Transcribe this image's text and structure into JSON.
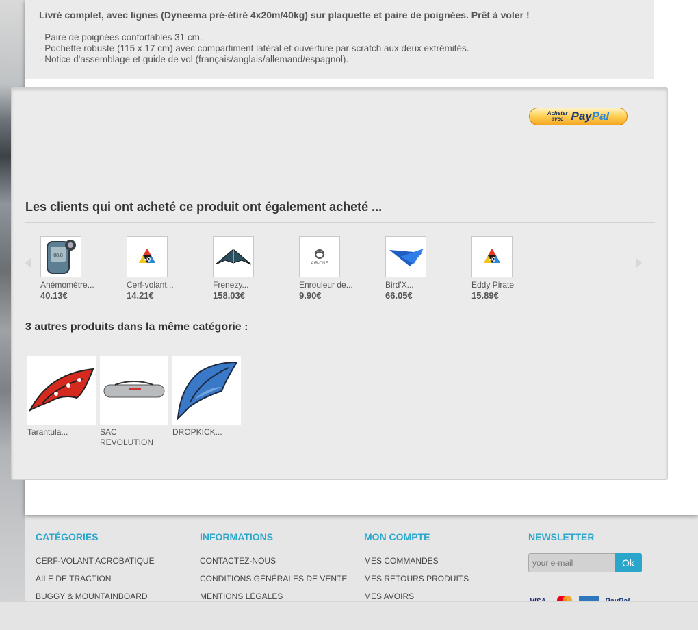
{
  "description": {
    "lead": "Livré complet, avec lignes (Dyneema pré-étiré 4x20m/40kg) sur plaquette et paire de poignées. Prêt à voler !",
    "lines": [
      "- Paire de poignées confortables 31 cm.",
      "- Pochette robuste (115 x 17 cm) avec compartiment latéral et ouverture par scratch aux deux extrémités.",
      "- Notice d'assemblage et guide de vol (français/anglais/allemand/espagnol)."
    ]
  },
  "paypal": {
    "line1": "Acheter",
    "line2": "avec",
    "brand_a": "Pay",
    "brand_b": "Pal"
  },
  "cross_selling": {
    "title": "Les clients qui ont acheté ce produit ont également acheté ...",
    "items": [
      {
        "name": "Anémomètre...",
        "price": "40.13€",
        "icon": "anemometer-icon"
      },
      {
        "name": "Cerf-volant...",
        "price": "14.21€",
        "icon": "hq-logo-icon"
      },
      {
        "name": "Frenezy...",
        "price": "158.03€",
        "icon": "stunt-kite-icon"
      },
      {
        "name": "Enrouleur de...",
        "price": "9.90€",
        "icon": "air-one-logo-icon"
      },
      {
        "name": "Bird'X...",
        "price": "66.05€",
        "icon": "blue-kite-icon"
      },
      {
        "name": "Eddy Pirate",
        "price": "15.89€",
        "icon": "hq-logo-icon"
      }
    ]
  },
  "category_products": {
    "title": "3 autres produits dans la même catégorie :",
    "items": [
      {
        "name": "Tarantula...",
        "icon": "red-kite-icon"
      },
      {
        "name": "SAC REVOLUTION",
        "icon": "kite-bag-icon"
      },
      {
        "name": "DROPKICK...",
        "icon": "blue-kite-icon"
      }
    ]
  },
  "footer": {
    "categories": {
      "title": "CATÉGORIES",
      "links": [
        "CERF-VOLANT ACROBATIQUE",
        "AILE DE TRACTION",
        "BUGGY & MOUNTAINBOARD"
      ]
    },
    "informations": {
      "title": "INFORMATIONS",
      "links": [
        "CONTACTEZ-NOUS",
        "CONDITIONS GÉNÉRALES DE VENTE",
        "MENTIONS LÉGALES"
      ]
    },
    "account": {
      "title": "MON COMPTE",
      "links": [
        "MES COMMANDES",
        "MES RETOURS PRODUITS",
        "MES AVOIRS"
      ]
    },
    "newsletter": {
      "title": "NEWSLETTER",
      "placeholder": "your e-mail",
      "button": "Ok"
    }
  },
  "colors": {
    "accent": "#2ba6cb",
    "panel": "#ebebeb"
  }
}
